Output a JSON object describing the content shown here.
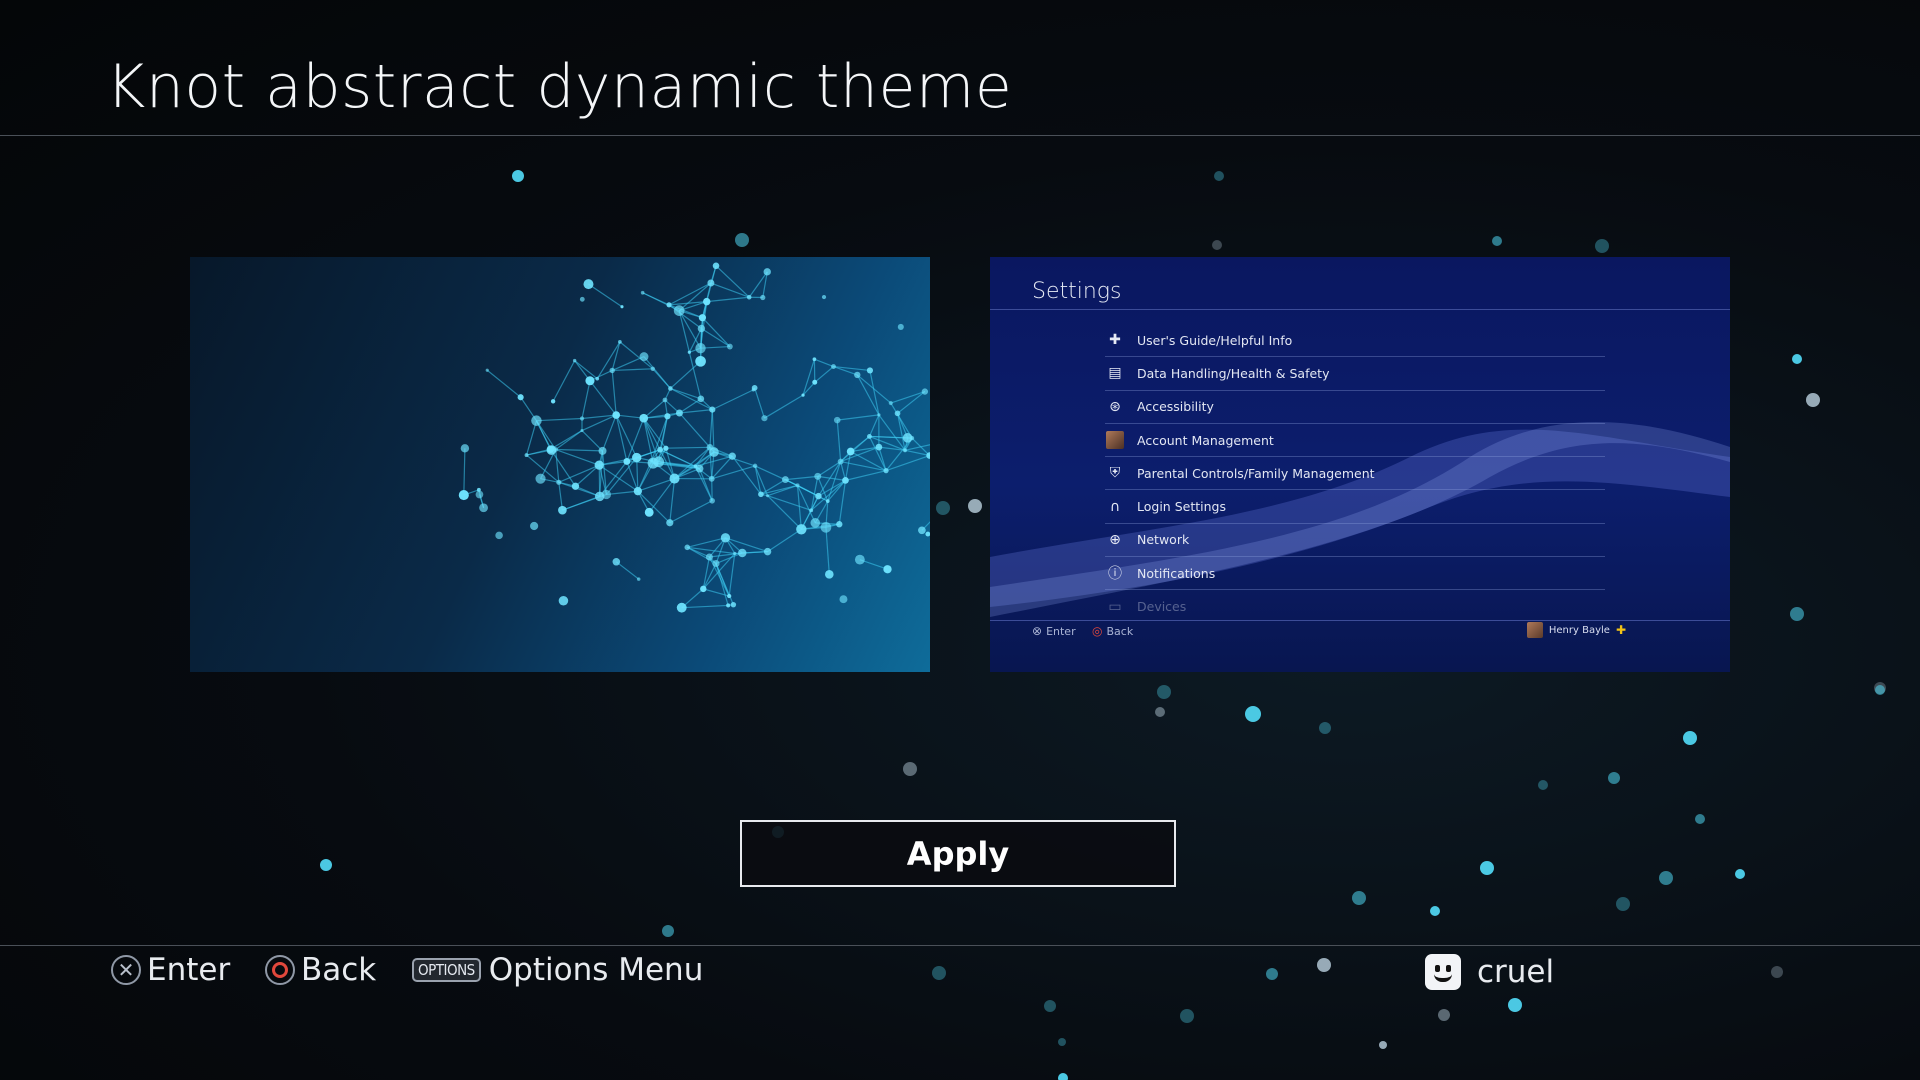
{
  "header": {
    "title": "Knot abstract dynamic theme"
  },
  "preview_settings": {
    "title": "Settings",
    "items": [
      {
        "icon": "users-guide-icon",
        "label": "User's Guide/Helpful Info"
      },
      {
        "icon": "data-handling-icon",
        "label": "Data Handling/Health & Safety"
      },
      {
        "icon": "accessibility-icon",
        "label": "Accessibility"
      },
      {
        "icon": "account-avatar-icon",
        "label": "Account Management"
      },
      {
        "icon": "parental-controls-icon",
        "label": "Parental Controls/Family Management"
      },
      {
        "icon": "login-icon",
        "label": "Login Settings"
      },
      {
        "icon": "network-globe-icon",
        "label": "Network"
      },
      {
        "icon": "notifications-info-icon",
        "label": "Notifications"
      },
      {
        "icon": "devices-icon",
        "label": "Devices"
      }
    ],
    "footer": {
      "enter": "Enter",
      "back": "Back",
      "user": "Henry Bayle"
    }
  },
  "apply_label": "Apply",
  "hints": {
    "enter": "Enter",
    "back": "Back",
    "options_key": "OPTIONS",
    "options": "Options Menu"
  },
  "user": {
    "name": "cruel"
  },
  "colors": {
    "accent_cyan": "#4fd3ee",
    "settings_blue": "#0c1e6d",
    "circle_red": "#e0483c",
    "plus_gold": "#f3c316"
  }
}
